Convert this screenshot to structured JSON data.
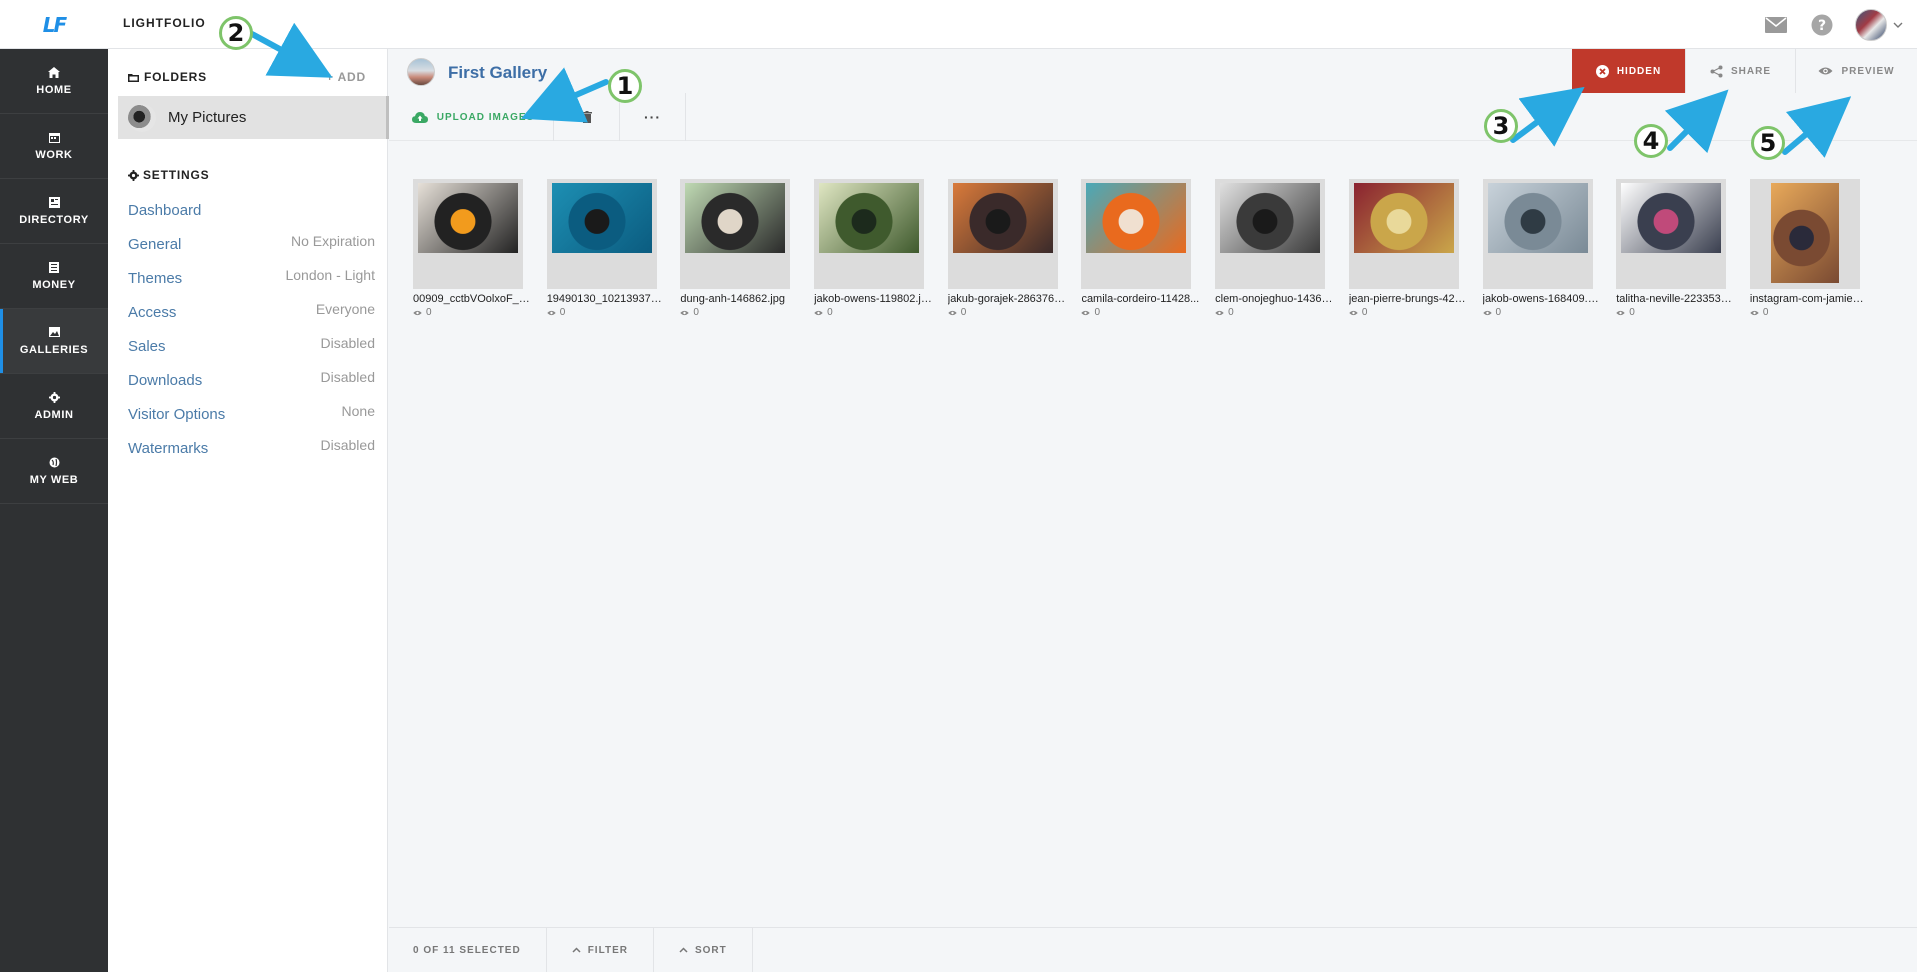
{
  "app": {
    "logo": "LF",
    "brand": "LIGHTFOLIO"
  },
  "topbar": {
    "icons": [
      "mail-icon",
      "help-icon",
      "avatar",
      "chevron-down-icon"
    ]
  },
  "nav": [
    {
      "label": "HOME",
      "icon": "home-icon"
    },
    {
      "label": "WORK",
      "icon": "calendar-icon"
    },
    {
      "label": "DIRECTORY",
      "icon": "directory-icon"
    },
    {
      "label": "MONEY",
      "icon": "document-icon"
    },
    {
      "label": "GALLERIES",
      "icon": "image-icon",
      "active": true
    },
    {
      "label": "ADMIN",
      "icon": "gear-icon"
    },
    {
      "label": "MY WEB",
      "icon": "globe-icon"
    }
  ],
  "panel": {
    "folders_label": "FOLDERS",
    "add_label": "+ ADD",
    "folder_name": "My Pictures",
    "settings_label": "SETTINGS",
    "settings": [
      {
        "name": "Dashboard",
        "value": ""
      },
      {
        "name": "General",
        "value": "No Expiration"
      },
      {
        "name": "Themes",
        "value": "London - Light"
      },
      {
        "name": "Access",
        "value": "Everyone"
      },
      {
        "name": "Sales",
        "value": "Disabled"
      },
      {
        "name": "Downloads",
        "value": "Disabled"
      },
      {
        "name": "Visitor Options",
        "value": "None"
      },
      {
        "name": "Watermarks",
        "value": "Disabled"
      }
    ]
  },
  "gallery": {
    "title": "First Gallery",
    "hidden_label": "HIDDEN",
    "share_label": "SHARE",
    "preview_label": "PREVIEW",
    "upload_label": "UPLOAD IMAGES",
    "more_label": "···",
    "images": [
      {
        "name": "00909_cctbVOolxoF_6...",
        "views": "0",
        "colors": [
          "#e6e0d8",
          "#222222",
          "#f29b1d"
        ]
      },
      {
        "name": "19490130_102139374...",
        "views": "0",
        "colors": [
          "#1d8fb3",
          "#0b5c80",
          "#1a1a1a"
        ]
      },
      {
        "name": "dung-anh-146862.jpg",
        "views": "0",
        "colors": [
          "#bfd9b3",
          "#2a2a2a",
          "#e0d6c8"
        ]
      },
      {
        "name": "jakob-owens-119802.jpg",
        "views": "0",
        "colors": [
          "#dfe6c2",
          "#3f5a2d",
          "#1c2a1c"
        ]
      },
      {
        "name": "jakub-gorajek-286376.j...",
        "views": "0",
        "colors": [
          "#d97a3a",
          "#3a2a2a",
          "#1a1a1a"
        ]
      },
      {
        "name": "camila-cordeiro-11428...",
        "views": "0",
        "colors": [
          "#4aa9b8",
          "#e96a1e",
          "#f0e0d0"
        ]
      },
      {
        "name": "clem-onojeghuo-14362...",
        "views": "0",
        "colors": [
          "#e0e0e0",
          "#3a3a3a",
          "#1a1a1a"
        ]
      },
      {
        "name": "jean-pierre-brungs-426...",
        "views": "0",
        "colors": [
          "#8a2230",
          "#caa64a",
          "#e9d99a"
        ]
      },
      {
        "name": "jakob-owens-168409.jpg",
        "views": "0",
        "colors": [
          "#c8d2da",
          "#7a8a96",
          "#2f3b44"
        ]
      },
      {
        "name": "talitha-neville-223353.j...",
        "views": "0",
        "colors": [
          "#ffffff",
          "#3a3f4f",
          "#c04a7a"
        ]
      },
      {
        "name": "instagram-com-jamie_f...",
        "views": "0",
        "colors": [
          "#e8a95a",
          "#7a4a32",
          "#2a2a3a"
        ],
        "tall": true
      }
    ]
  },
  "bottom": {
    "selected": "0 OF 11 SELECTED",
    "filter": "FILTER",
    "sort": "SORT"
  },
  "callouts": [
    "1",
    "2",
    "3",
    "4",
    "5"
  ],
  "colors": {
    "accent": "#1f8fe6",
    "hidden": "#c0392b",
    "upload": "#3aa864",
    "link": "#4b7ba8",
    "callout_ring": "#7ec46a",
    "arrow": "#29a9e1"
  }
}
